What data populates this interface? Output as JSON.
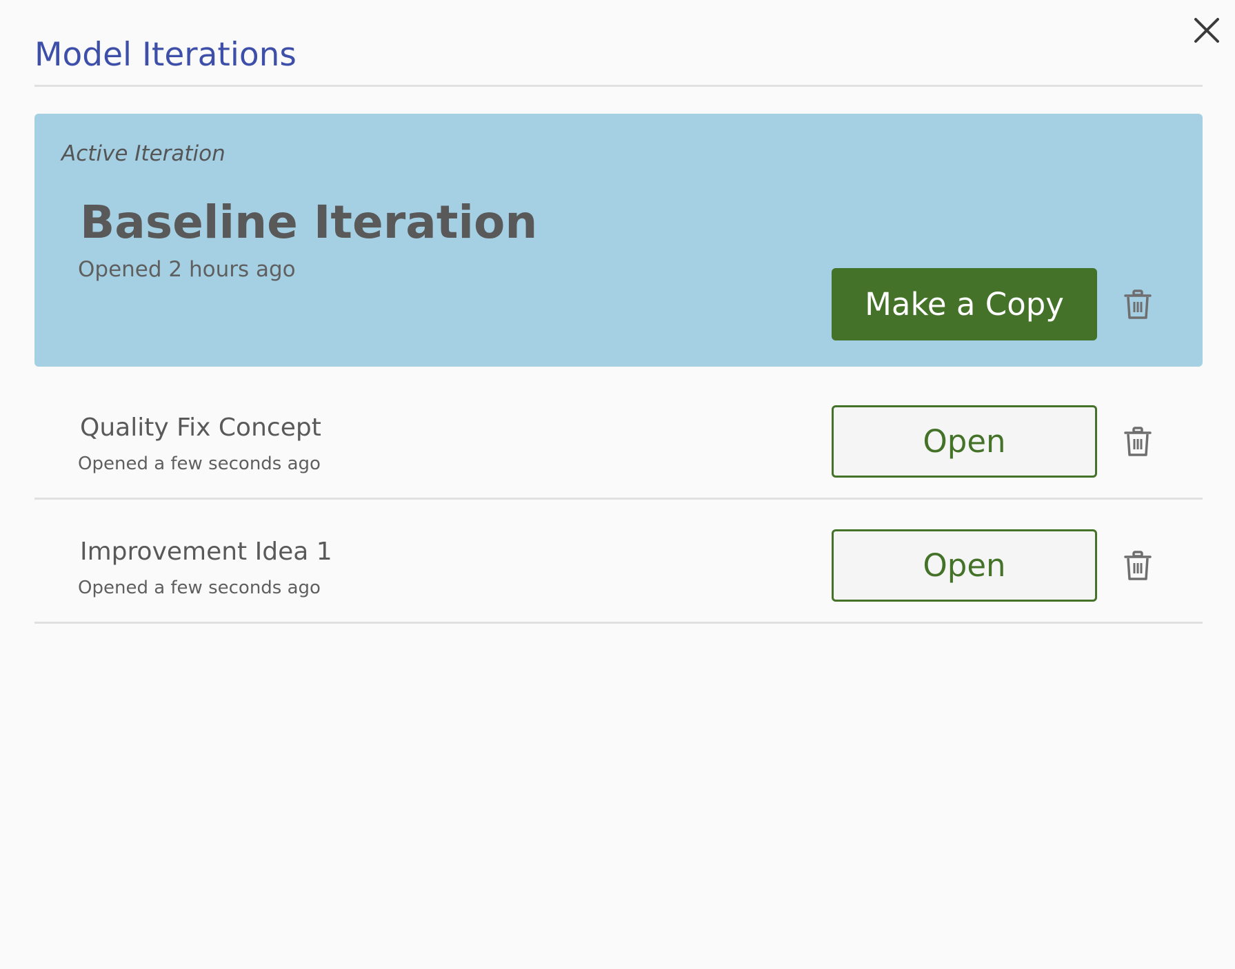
{
  "dialog": {
    "title": "Model Iterations",
    "close_icon": "close-icon"
  },
  "active": {
    "label": "Active Iteration",
    "name": "Baseline Iteration",
    "opened": "Opened 2 hours ago",
    "copy_label": "Make a Copy",
    "delete_icon": "trash-icon"
  },
  "iterations": [
    {
      "name": "Quality Fix Concept",
      "opened": "Opened a few seconds ago",
      "open_label": "Open",
      "delete_icon": "trash-icon"
    },
    {
      "name": "Improvement Idea 1",
      "opened": "Opened a few seconds ago",
      "open_label": "Open",
      "delete_icon": "trash-icon"
    }
  ],
  "colors": {
    "title": "#3d4fa8",
    "active_card": "#a5d0e4",
    "primary_green": "#447228",
    "divider": "#e0e0e0"
  }
}
